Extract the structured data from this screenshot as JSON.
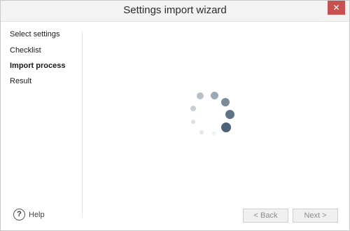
{
  "window": {
    "title": "Settings import wizard",
    "close_glyph": "✕"
  },
  "nav": {
    "items": [
      {
        "label": "Select settings",
        "active": false
      },
      {
        "label": "Checklist",
        "active": false
      },
      {
        "label": "Import process",
        "active": true
      },
      {
        "label": "Result",
        "active": false
      }
    ]
  },
  "status": {
    "spinner_icon": "loading-spinner-icon",
    "spinner_color": "#4d6478"
  },
  "footer": {
    "help_icon_glyph": "?",
    "help_label": "Help",
    "back_label": "< Back",
    "next_label": "Next >"
  }
}
